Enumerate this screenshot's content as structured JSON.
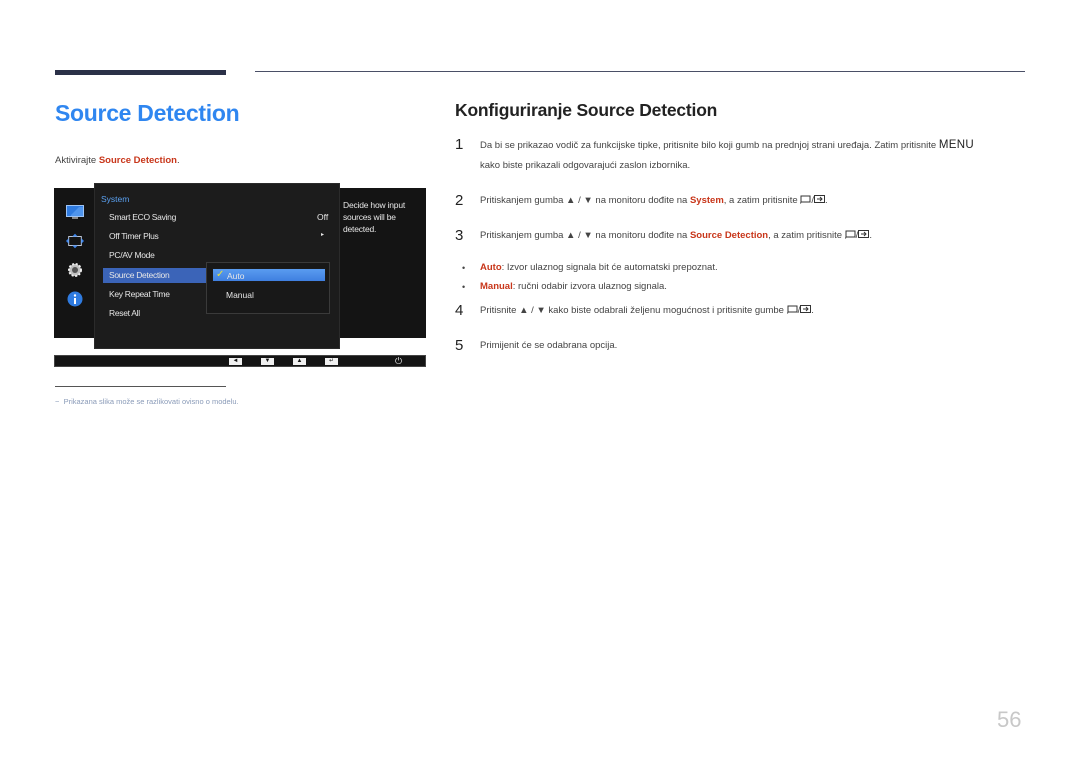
{
  "header": {
    "section_title": "Source Detection",
    "activate_prefix": "Aktivirajte ",
    "activate_highlight": "Source Detection",
    "activate_suffix": "."
  },
  "osd": {
    "sidebar_icons": [
      "monitor-icon",
      "resize-arrows-icon",
      "gear-icon",
      "info-icon"
    ],
    "menu_heading": "System",
    "menu_items": [
      {
        "label": "Smart ECO Saving",
        "value": "Off"
      },
      {
        "label": "Off Timer Plus",
        "value": "▸"
      },
      {
        "label": "PC/AV Mode",
        "value": ""
      },
      {
        "label": "Source Detection",
        "value": "",
        "selected": true
      },
      {
        "label": "Key Repeat Time",
        "value": ""
      },
      {
        "label": "Reset All",
        "value": ""
      }
    ],
    "submenu": [
      {
        "label": "Auto",
        "selected": true,
        "checkmark": "✓"
      },
      {
        "label": "Manual",
        "selected": false
      }
    ],
    "help_text": "Decide how input sources will be detected.",
    "bottom_keys": [
      "◄",
      "▼",
      "▲",
      "↵"
    ],
    "power_symbol": "⏻"
  },
  "footnote": {
    "dash": "−",
    "text": "Prikazana slika može se razlikovati ovisno o modelu."
  },
  "instructions": {
    "title": "Konfiguriranje Source Detection",
    "steps": [
      {
        "num": "1",
        "line1": "Da bi se prikazao vodič za funkcijske tipke, pritisnite bilo koji gumb na prednjoj strani uređaja. Zatim pritisnite ",
        "keyword": "MENU",
        "line2": "kako biste prikazali odgovarajući zaslon izbornika."
      },
      {
        "num": "2",
        "prefix": "Pritiskanjem gumba ▲ / ▼ na monitoru dođite na ",
        "highlight": "System",
        "suffix": ", a zatim pritisnite "
      },
      {
        "num": "3",
        "prefix": "Pritiskanjem gumba ▲ / ▼ na monitoru dođite na ",
        "highlight": "Source Detection",
        "suffix": ", a zatim pritisnite "
      },
      {
        "num": "4",
        "prefix": "Pritisnite ▲ / ▼ kako biste odabrali željenu mogućnost i pritisnite gumbe "
      },
      {
        "num": "5",
        "text": "Primijenit će se odabrana opcija."
      }
    ],
    "bullets": [
      {
        "mark": "•",
        "label": "Auto",
        "text": ": Izvor ulaznog signala bit će automatski prepoznat."
      },
      {
        "mark": "•",
        "label": "Manual",
        "text": ": ručni odabir izvora ulaznog signala."
      }
    ],
    "key_separator": "/",
    "end_period": "."
  },
  "page_number": "56"
}
